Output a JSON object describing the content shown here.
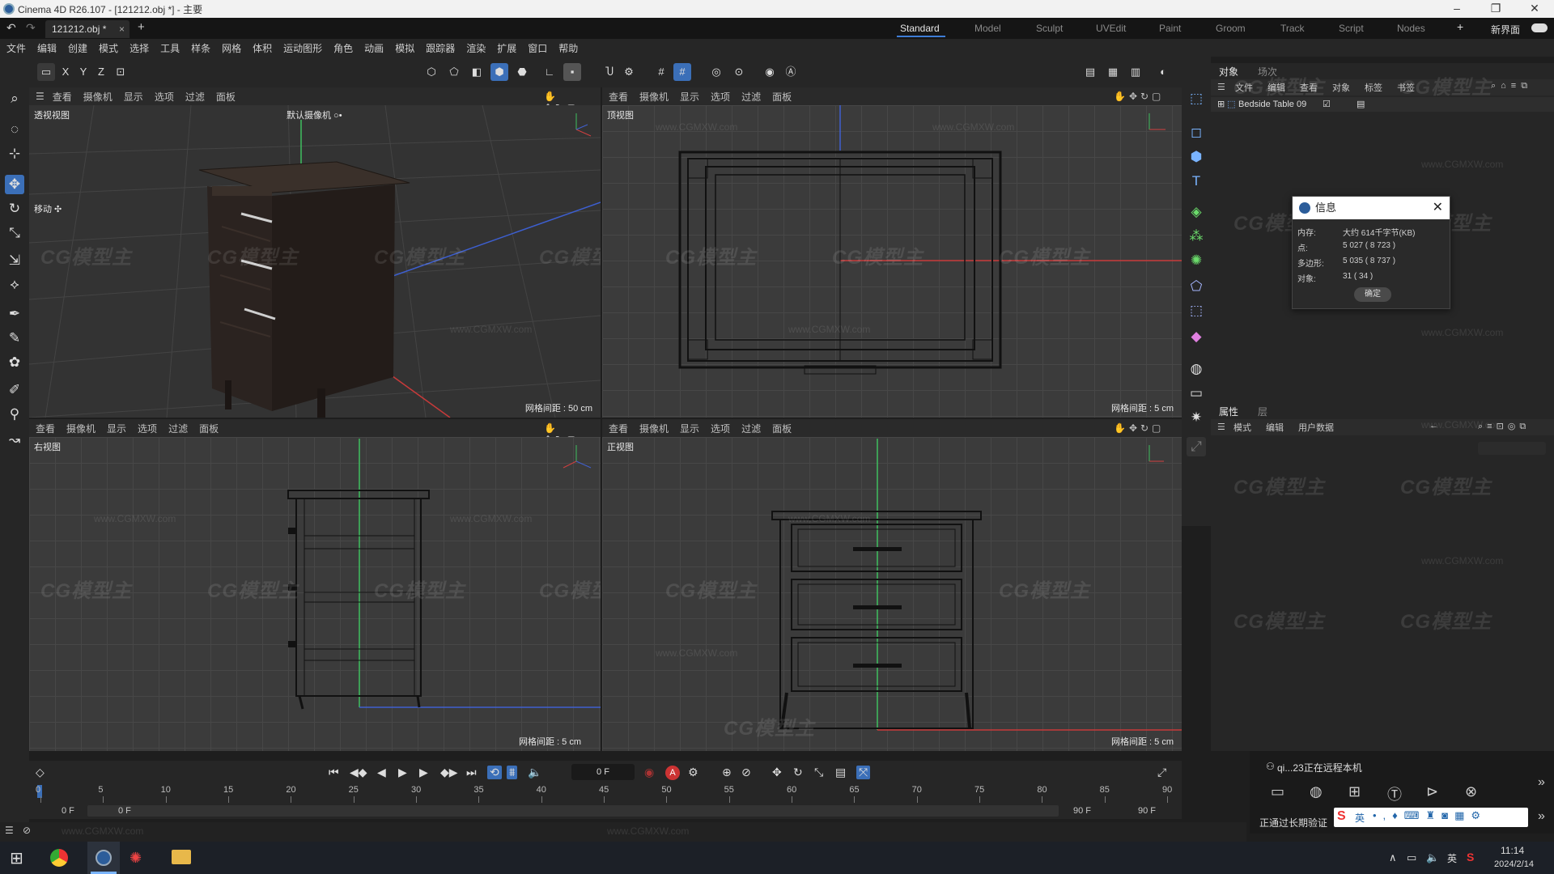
{
  "window": {
    "title": "Cinema 4D R26.107 - [121212.obj *] - 主要",
    "controls": [
      "–",
      "❐",
      "✕"
    ]
  },
  "doc_tab": {
    "label": "121212.obj *",
    "close": "×",
    "add": "+"
  },
  "layouts": {
    "items": [
      "Standard",
      "Model",
      "Sculpt",
      "UVEdit",
      "Paint",
      "Groom",
      "Track",
      "Script",
      "Nodes"
    ],
    "active": "Standard",
    "new": "新界面",
    "add": "+"
  },
  "menu": [
    "文件",
    "编辑",
    "创建",
    "模式",
    "选择",
    "工具",
    "样条",
    "网格",
    "体积",
    "运动图形",
    "角色",
    "动画",
    "模拟",
    "跟踪器",
    "渲染",
    "扩展",
    "窗口",
    "帮助"
  ],
  "toolbar": {
    "axes": [
      "X",
      "Y",
      "Z"
    ]
  },
  "viewport_menu": [
    "查看",
    "摄像机",
    "显示",
    "选项",
    "过滤",
    "面板"
  ],
  "viewports": {
    "perspective": {
      "title": "透视视图",
      "camera": "默认摄像机 ○•",
      "grid": "网格间距 : 50 cm",
      "mode": "移动 ✣"
    },
    "top": {
      "title": "顶视图",
      "grid": "网格间距 : 5 cm"
    },
    "right": {
      "title": "右视图",
      "grid": "网格间距 : 5 cm"
    },
    "front": {
      "title": "正视图",
      "grid": "网格间距 : 5 cm"
    }
  },
  "watermark": {
    "text": "CG模型主",
    "url": "www.CGMXW.com"
  },
  "object_manager": {
    "tabs": [
      "对象",
      "场次"
    ],
    "menu": [
      "文件",
      "编辑",
      "查看",
      "对象",
      "标签",
      "书签"
    ],
    "object": "Bedside Table 09"
  },
  "info_dialog": {
    "title": "信息",
    "rows": [
      {
        "label": "内存:",
        "value": "大约 614千字节(KB)"
      },
      {
        "label": "点:",
        "value": "5 027 ( 8 723 )"
      },
      {
        "label": "多边形:",
        "value": "5 035 ( 8 737 )"
      },
      {
        "label": "对象:",
        "value": "31 ( 34 )"
      }
    ],
    "ok": "确定"
  },
  "attributes": {
    "tabs": [
      "属性",
      "层"
    ],
    "menu": [
      "模式",
      "编辑",
      "用户数据"
    ]
  },
  "timeline": {
    "current_frame": "0 F",
    "ticks": [
      "0",
      "5",
      "10",
      "15",
      "20",
      "25",
      "30",
      "35",
      "40",
      "45",
      "50",
      "55",
      "60",
      "65",
      "70",
      "75",
      "80",
      "85",
      "90"
    ],
    "start": "0 F",
    "start2": "0 F",
    "end": "90 F",
    "end2": "90 F"
  },
  "remote": {
    "user": "qi...23正在远程本机",
    "status": "正通过长期验证"
  },
  "taskbar": {
    "time": "11:14",
    "date": "2024/2/14",
    "lang": "英",
    "ime": "英"
  },
  "colors": {
    "accent": "#3b6fb8",
    "axis_green": "#3fbf5f",
    "axis_red": "#d04040",
    "axis_blue": "#4060d0"
  }
}
